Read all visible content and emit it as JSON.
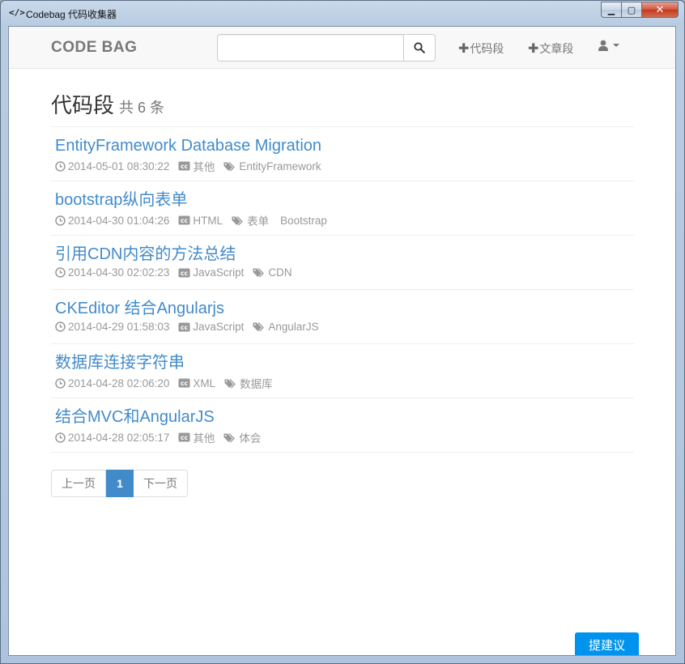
{
  "window": {
    "icon": "</>",
    "title": "Codebag 代码收集器",
    "minimize": "▁",
    "maximize": "▢",
    "close": "✕"
  },
  "navbar": {
    "brand": "CODE BAG",
    "search_value": "",
    "nav_code_label": "代码段",
    "nav_article_label": "文章段"
  },
  "header": {
    "title": "代码段",
    "count": "共 6 条"
  },
  "items": [
    {
      "title": "EntityFramework Database Migration",
      "time": "2014-05-01 08:30:22",
      "lang": "其他",
      "tags": [
        "EntityFramework"
      ]
    },
    {
      "title": "bootstrap纵向表单",
      "time": "2014-04-30 01:04:26",
      "lang": "HTML",
      "tags": [
        "表单",
        "Bootstrap"
      ]
    },
    {
      "title": "引用CDN内容的方法总结",
      "time": "2014-04-30 02:02:23",
      "lang": "JavaScript",
      "tags": [
        "CDN"
      ]
    },
    {
      "title": "CKEditor 结合Angularjs",
      "time": "2014-04-29 01:58:03",
      "lang": "JavaScript",
      "tags": [
        "AngularJS"
      ]
    },
    {
      "title": "数据库连接字符串",
      "time": "2014-04-28 02:06:20",
      "lang": "XML",
      "tags": [
        "数据库"
      ]
    },
    {
      "title": "结合MVC和AngularJS",
      "time": "2014-04-28 02:05:17",
      "lang": "其他",
      "tags": [
        "体会"
      ]
    }
  ],
  "pagination": {
    "prev": "上一页",
    "current": "1",
    "next": "下一页"
  },
  "feedback": {
    "label": "提建议"
  },
  "colors": {
    "link": "#428bca",
    "meta": "#999999",
    "feedback": "#0093ed"
  }
}
